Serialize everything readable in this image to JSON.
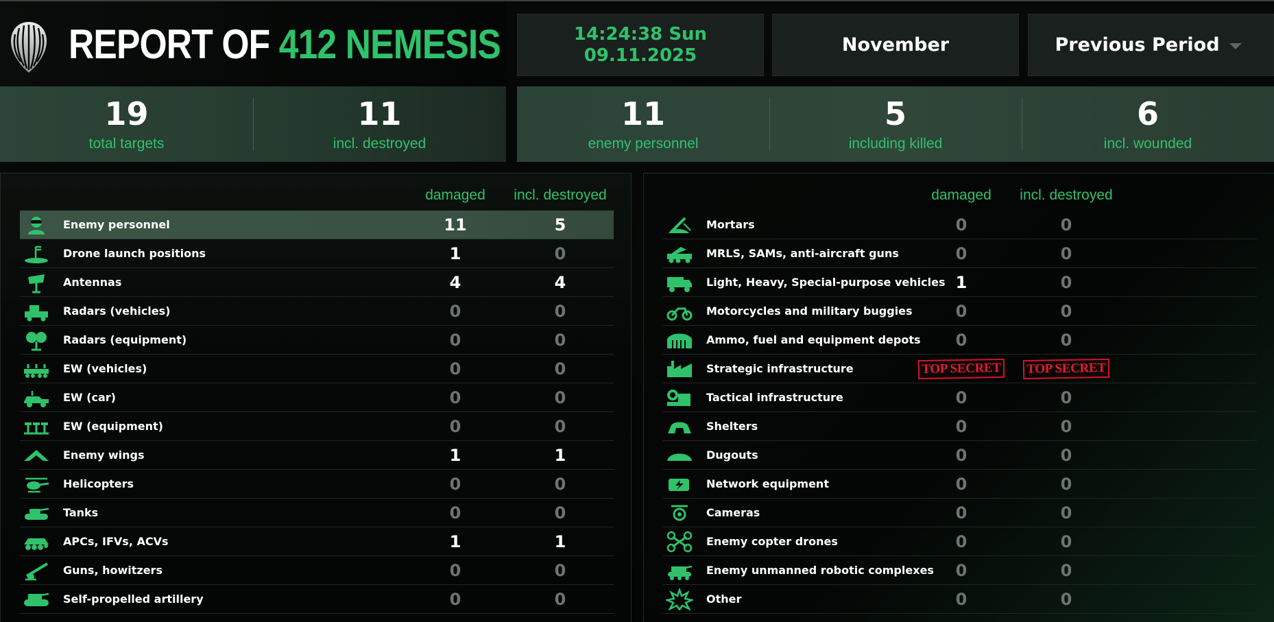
{
  "header": {
    "title_prefix": "REPORT OF",
    "title_unit": "412 NEMESIS",
    "time": "14:24:38 Sun",
    "date": "09.11.2025",
    "month": "November",
    "period": "Previous Period"
  },
  "summary": {
    "left": [
      {
        "value": "19",
        "label": "total targets"
      },
      {
        "value": "11",
        "label": "incl. destroyed"
      }
    ],
    "right": [
      {
        "value": "11",
        "label": "enemy personnel"
      },
      {
        "value": "5",
        "label": "including killed"
      },
      {
        "value": "6",
        "label": "incl. wounded"
      }
    ]
  },
  "columns": {
    "damaged": "damaged",
    "destroyed": "incl. destroyed"
  },
  "left_table": [
    {
      "icon": "soldier-icon",
      "name": "Enemy personnel",
      "damaged": "11",
      "destroyed": "5",
      "highlight": true
    },
    {
      "icon": "drone-launch-icon",
      "name": "Drone launch positions",
      "damaged": "1",
      "destroyed": "0"
    },
    {
      "icon": "antenna-icon",
      "name": "Antennas",
      "damaged": "4",
      "destroyed": "4"
    },
    {
      "icon": "radar-vehicle-icon",
      "name": "Radars (vehicles)",
      "damaged": "0",
      "destroyed": "0"
    },
    {
      "icon": "radar-equipment-icon",
      "name": "Radars (equipment)",
      "damaged": "0",
      "destroyed": "0"
    },
    {
      "icon": "ew-vehicle-icon",
      "name": "EW (vehicles)",
      "damaged": "0",
      "destroyed": "0"
    },
    {
      "icon": "ew-car-icon",
      "name": "EW (car)",
      "damaged": "0",
      "destroyed": "0"
    },
    {
      "icon": "ew-equipment-icon",
      "name": "EW (equipment)",
      "damaged": "0",
      "destroyed": "0"
    },
    {
      "icon": "wings-icon",
      "name": "Enemy wings",
      "damaged": "1",
      "destroyed": "1"
    },
    {
      "icon": "helicopter-icon",
      "name": "Helicopters",
      "damaged": "0",
      "destroyed": "0"
    },
    {
      "icon": "tank-icon",
      "name": "Tanks",
      "damaged": "0",
      "destroyed": "0"
    },
    {
      "icon": "apc-icon",
      "name": "APCs, IFVs, ACVs",
      "damaged": "1",
      "destroyed": "1"
    },
    {
      "icon": "howitzer-icon",
      "name": "Guns, howitzers",
      "damaged": "0",
      "destroyed": "0"
    },
    {
      "icon": "spg-icon",
      "name": "Self-propelled artillery",
      "damaged": "0",
      "destroyed": "0"
    }
  ],
  "right_table": [
    {
      "icon": "mortar-icon",
      "name": "Mortars",
      "damaged": "0",
      "destroyed": "0"
    },
    {
      "icon": "mlrs-icon",
      "name": "MRLS, SAMs, anti-aircraft guns",
      "damaged": "0",
      "destroyed": "0"
    },
    {
      "icon": "truck-icon",
      "name": "Light, Heavy, Special-purpose vehicles",
      "damaged": "1",
      "destroyed": "0"
    },
    {
      "icon": "motorcycle-icon",
      "name": "Motorcycles and military buggies",
      "damaged": "0",
      "destroyed": "0"
    },
    {
      "icon": "depot-icon",
      "name": "Ammo, fuel and equipment depots",
      "damaged": "0",
      "destroyed": "0"
    },
    {
      "icon": "factory-icon",
      "name": "Strategic infrastructure",
      "damaged": "TOP SECRET",
      "destroyed": "TOP SECRET",
      "secret": true
    },
    {
      "icon": "tactical-infra-icon",
      "name": "Tactical infrastructure",
      "damaged": "0",
      "destroyed": "0"
    },
    {
      "icon": "shelter-icon",
      "name": "Shelters",
      "damaged": "0",
      "destroyed": "0"
    },
    {
      "icon": "dugout-icon",
      "name": "Dugouts",
      "damaged": "0",
      "destroyed": "0"
    },
    {
      "icon": "network-icon",
      "name": "Network equipment",
      "damaged": "0",
      "destroyed": "0"
    },
    {
      "icon": "camera-icon",
      "name": "Cameras",
      "damaged": "0",
      "destroyed": "0"
    },
    {
      "icon": "copter-drone-icon",
      "name": "Enemy copter drones",
      "damaged": "0",
      "destroyed": "0"
    },
    {
      "icon": "robot-icon",
      "name": "Enemy unmanned robotic complexes",
      "damaged": "0",
      "destroyed": "0"
    },
    {
      "icon": "explosion-icon",
      "name": "Other",
      "damaged": "0",
      "destroyed": "0"
    }
  ],
  "colors": {
    "accent": "#2fc26b",
    "muted": "#6c7470",
    "stamp": "#e31b32"
  }
}
